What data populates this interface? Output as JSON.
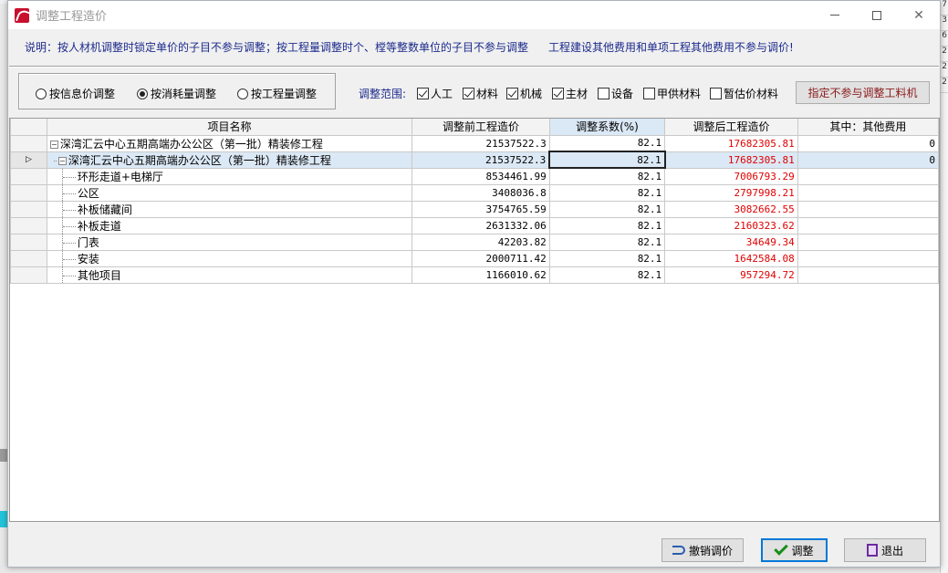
{
  "window": {
    "title": "调整工程造价"
  },
  "note": {
    "left": "说明：按人材机调整时锁定单价的子目不参与调整；按工程量调整时个、樘等整数单位的子目不参与调整",
    "right": "工程建设其他费用和单项工程其他费用不参与调价!"
  },
  "mode": {
    "options": [
      "按信息价调整",
      "按消耗量调整",
      "按工程量调整"
    ],
    "selected": "按消耗量调整"
  },
  "range": {
    "label": "调整范围:",
    "items": [
      {
        "label": "人工",
        "checked": true
      },
      {
        "label": "材料",
        "checked": true
      },
      {
        "label": "机械",
        "checked": true
      },
      {
        "label": "主材",
        "checked": true
      },
      {
        "label": "设备",
        "checked": false
      },
      {
        "label": "甲供材料",
        "checked": false
      },
      {
        "label": "暂估价材料",
        "checked": false
      }
    ]
  },
  "buttons": {
    "exclude": "指定不参与调整工料机",
    "undo": "撤销调价",
    "adjust": "调整",
    "exit": "退出"
  },
  "table": {
    "headers": [
      "项目名称",
      "调整前工程造价",
      "调整系数(%)",
      "调整后工程造价",
      "其中：其他费用"
    ],
    "rows": [
      {
        "name": "深湾汇云中心五期高端办公公区（第一批）精装修工程",
        "before": "21537522.3",
        "coef": "82.1",
        "after": "17682305.81",
        "other": "0",
        "level": 0
      },
      {
        "name": "深湾汇云中心五期高端办公公区（第一批）精装修工程",
        "before": "21537522.3",
        "coef": "82.1",
        "after": "17682305.81",
        "other": "0",
        "level": 1,
        "selected": true
      },
      {
        "name": "环形走道+电梯厅",
        "before": "8534461.99",
        "coef": "82.1",
        "after": "7006793.29",
        "other": "",
        "level": 2
      },
      {
        "name": "公区",
        "before": "3408036.8",
        "coef": "82.1",
        "after": "2797998.21",
        "other": "",
        "level": 2
      },
      {
        "name": "补板储藏间",
        "before": "3754765.59",
        "coef": "82.1",
        "after": "3082662.55",
        "other": "",
        "level": 2
      },
      {
        "name": "补板走道",
        "before": "2631332.06",
        "coef": "82.1",
        "after": "2160323.62",
        "other": "",
        "level": 2
      },
      {
        "name": "门表",
        "before": "42203.82",
        "coef": "82.1",
        "after": "34649.34",
        "other": "",
        "level": 2
      },
      {
        "name": "安装",
        "before": "2000711.42",
        "coef": "82.1",
        "after": "1642584.08",
        "other": "",
        "level": 2
      },
      {
        "name": "其他项目",
        "before": "1166010.62",
        "coef": "82.1",
        "after": "957294.72",
        "other": "",
        "level": 2
      }
    ]
  },
  "background": {
    "right_digits": [
      "7",
      "3",
      "6",
      "2",
      "2",
      "2"
    ]
  },
  "colors": {
    "note_text": "#1c2a8c",
    "value_red": "#e00000",
    "selection": "#dbe8f5"
  }
}
